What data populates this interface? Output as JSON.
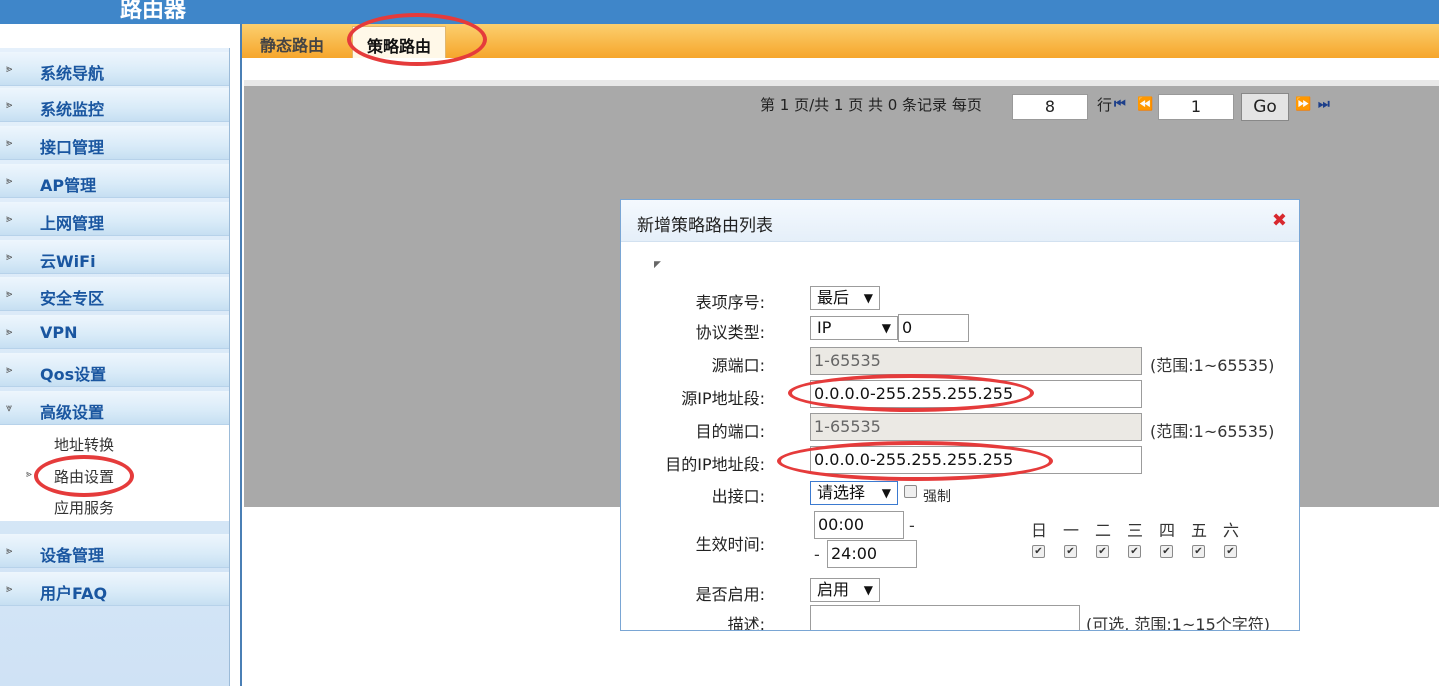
{
  "app": {
    "title": "路由器",
    "logo": ""
  },
  "sidebar": {
    "items": [
      {
        "label": "系统导航"
      },
      {
        "label": "系统监控"
      },
      {
        "label": "接口管理"
      },
      {
        "label": "AP管理"
      },
      {
        "label": "上网管理"
      },
      {
        "label": "云WiFi"
      },
      {
        "label": "安全专区"
      },
      {
        "label": "VPN"
      },
      {
        "label": "Qos设置"
      },
      {
        "label": "高级设置"
      },
      {
        "label": "设备管理"
      },
      {
        "label": "用户FAQ"
      }
    ],
    "subitems": [
      {
        "label": "地址转换"
      },
      {
        "label": "路由设置"
      },
      {
        "label": "应用服务"
      }
    ]
  },
  "tabs": [
    {
      "label": "静态路由"
    },
    {
      "label": "策略路由"
    }
  ],
  "pager": {
    "text": "第 1 页/共 1 页 共 0 条记录 每页",
    "per_page": "8",
    "row_label": "行",
    "page": "1",
    "go": "Go"
  },
  "dialog": {
    "title": "新增策略路由列表",
    "fields": {
      "index_label": "表项序号:",
      "index_value": "最后",
      "protocol_label": "协议类型:",
      "protocol_value": "IP",
      "protocol_number": "0",
      "src_port_label": "源端口:",
      "src_port_value": "1-65535",
      "src_port_note": "(范围:1~65535)",
      "src_ip_label": "源IP地址段:",
      "src_ip_value": "0.0.0.0-255.255.255.255",
      "dst_port_label": "目的端口:",
      "dst_port_value": "1-65535",
      "dst_port_note": "(范围:1~65535)",
      "dst_ip_label": "目的IP地址段:",
      "dst_ip_value": "0.0.0.0-255.255.255.255",
      "out_if_label": "出接口:",
      "out_if_value": "请选择",
      "force_label": "强制",
      "time_label": "生效时间:",
      "time_start": "00:00",
      "time_end": "24:00",
      "time_dash": "-",
      "days": [
        "日",
        "一",
        "二",
        "三",
        "四",
        "五",
        "六"
      ],
      "enable_label": "是否启用:",
      "enable_value": "启用",
      "desc_label": "描述:",
      "desc_value": "",
      "desc_note": "(可选, 范围:1~15个字符)"
    }
  },
  "colors": {
    "topbar": "#3f86c9",
    "tabbar": "#f6a62c",
    "highlight": "#e53b3b",
    "link": "#1a56a0"
  }
}
